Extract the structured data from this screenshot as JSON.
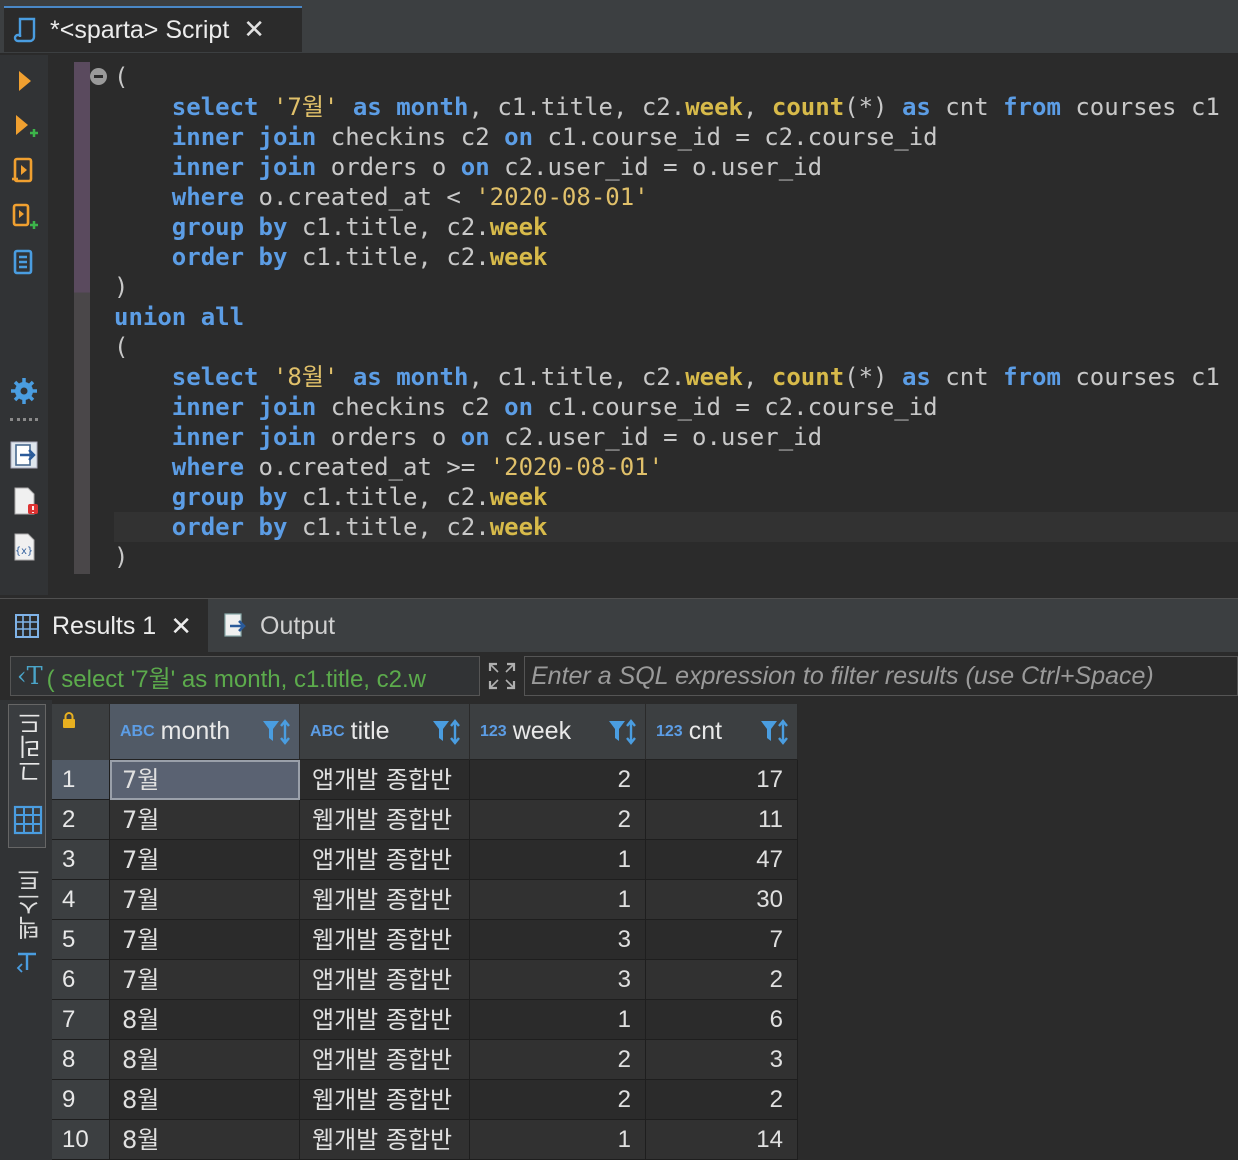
{
  "editor_tab": {
    "title": "*<sparta> Script",
    "close": "✕"
  },
  "code_lines": [
    [
      [
        "t",
        "("
      ]
    ],
    [
      [
        "t",
        "    "
      ],
      [
        "kw",
        "select"
      ],
      [
        "t",
        " "
      ],
      [
        "str",
        "'7월'"
      ],
      [
        "t",
        " "
      ],
      [
        "kw",
        "as"
      ],
      [
        "t",
        " "
      ],
      [
        "kw",
        "month"
      ],
      [
        "t",
        ", c1.title, c2."
      ],
      [
        "col",
        "week"
      ],
      [
        "t",
        ", "
      ],
      [
        "fn",
        "count"
      ],
      [
        "t",
        "(*) "
      ],
      [
        "kw",
        "as"
      ],
      [
        "t",
        " cnt "
      ],
      [
        "kw",
        "from"
      ],
      [
        "t",
        " courses c1"
      ]
    ],
    [
      [
        "t",
        "    "
      ],
      [
        "kw",
        "inner join"
      ],
      [
        "t",
        " checkins c2 "
      ],
      [
        "kw",
        "on"
      ],
      [
        "t",
        " c1.course_id = c2.course_id"
      ]
    ],
    [
      [
        "t",
        "    "
      ],
      [
        "kw",
        "inner join"
      ],
      [
        "t",
        " orders o "
      ],
      [
        "kw",
        "on"
      ],
      [
        "t",
        " c2.user_id = o.user_id"
      ]
    ],
    [
      [
        "t",
        "    "
      ],
      [
        "kw",
        "where"
      ],
      [
        "t",
        " o.created_at < "
      ],
      [
        "str",
        "'2020-08-01'"
      ]
    ],
    [
      [
        "t",
        "    "
      ],
      [
        "kw",
        "group by"
      ],
      [
        "t",
        " c1.title, c2."
      ],
      [
        "col",
        "week"
      ]
    ],
    [
      [
        "t",
        "    "
      ],
      [
        "kw",
        "order by"
      ],
      [
        "t",
        " c1.title, c2."
      ],
      [
        "col",
        "week"
      ]
    ],
    [
      [
        "t",
        ")"
      ]
    ],
    [
      [
        "kw",
        "union all"
      ]
    ],
    [
      [
        "t",
        "("
      ]
    ],
    [
      [
        "t",
        "    "
      ],
      [
        "kw",
        "select"
      ],
      [
        "t",
        " "
      ],
      [
        "str",
        "'8월'"
      ],
      [
        "t",
        " "
      ],
      [
        "kw",
        "as"
      ],
      [
        "t",
        " "
      ],
      [
        "kw",
        "month"
      ],
      [
        "t",
        ", c1.title, c2."
      ],
      [
        "col",
        "week"
      ],
      [
        "t",
        ", "
      ],
      [
        "fn",
        "count"
      ],
      [
        "t",
        "(*) "
      ],
      [
        "kw",
        "as"
      ],
      [
        "t",
        " cnt "
      ],
      [
        "kw",
        "from"
      ],
      [
        "t",
        " courses c1"
      ]
    ],
    [
      [
        "t",
        "    "
      ],
      [
        "kw",
        "inner join"
      ],
      [
        "t",
        " checkins c2 "
      ],
      [
        "kw",
        "on"
      ],
      [
        "t",
        " c1.course_id = c2.course_id"
      ]
    ],
    [
      [
        "t",
        "    "
      ],
      [
        "kw",
        "inner join"
      ],
      [
        "t",
        " orders o "
      ],
      [
        "kw",
        "on"
      ],
      [
        "t",
        " c2.user_id = o.user_id"
      ]
    ],
    [
      [
        "t",
        "    "
      ],
      [
        "kw",
        "where"
      ],
      [
        "t",
        " o.created_at >= "
      ],
      [
        "str",
        "'2020-08-01'"
      ]
    ],
    [
      [
        "t",
        "    "
      ],
      [
        "kw",
        "group by"
      ],
      [
        "t",
        " c1.title, c2."
      ],
      [
        "col",
        "week"
      ]
    ],
    [
      [
        "t",
        "    "
      ],
      [
        "kw",
        "order by"
      ],
      [
        "t",
        " c1.title, c2."
      ],
      [
        "col",
        "week"
      ]
    ],
    [
      [
        "t",
        ")"
      ]
    ]
  ],
  "current_line_index": 15,
  "result_tabs": {
    "results_label": "Results 1",
    "results_close": "✕",
    "output_label": "Output"
  },
  "filter": {
    "query_icon": "‹T",
    "query_preview": "( select '7월' as month, c1.title, c2.w",
    "placeholder": "Enter a SQL expression to filter results (use Ctrl+Space)"
  },
  "side_panel": {
    "grid_label": "그리드",
    "text_label": "텍스트"
  },
  "columns": [
    {
      "type": "ABC",
      "name": "month"
    },
    {
      "type": "ABC",
      "name": "title"
    },
    {
      "type": "123",
      "name": "week"
    },
    {
      "type": "123",
      "name": "cnt"
    }
  ],
  "rows": [
    {
      "n": "1",
      "month": "7월",
      "title": "앱개발 종합반",
      "week": "2",
      "cnt": "17"
    },
    {
      "n": "2",
      "month": "7월",
      "title": "웹개발 종합반",
      "week": "2",
      "cnt": "11"
    },
    {
      "n": "3",
      "month": "7월",
      "title": "앱개발 종합반",
      "week": "1",
      "cnt": "47"
    },
    {
      "n": "4",
      "month": "7월",
      "title": "웹개발 종합반",
      "week": "1",
      "cnt": "30"
    },
    {
      "n": "5",
      "month": "7월",
      "title": "웹개발 종합반",
      "week": "3",
      "cnt": "7"
    },
    {
      "n": "6",
      "month": "7월",
      "title": "앱개발 종합반",
      "week": "3",
      "cnt": "2"
    },
    {
      "n": "7",
      "month": "8월",
      "title": "앱개발 종합반",
      "week": "1",
      "cnt": "6"
    },
    {
      "n": "8",
      "month": "8월",
      "title": "앱개발 종합반",
      "week": "2",
      "cnt": "3"
    },
    {
      "n": "9",
      "month": "8월",
      "title": "웹개발 종합반",
      "week": "2",
      "cnt": "2"
    },
    {
      "n": "10",
      "month": "8월",
      "title": "웹개발 종합반",
      "week": "1",
      "cnt": "14"
    }
  ],
  "colors": {
    "keyword": "#5c9de5",
    "function": "#d7ba4a",
    "string": "#e0c06a",
    "accent": "#4a88c7",
    "query_green": "#5cab4c"
  }
}
